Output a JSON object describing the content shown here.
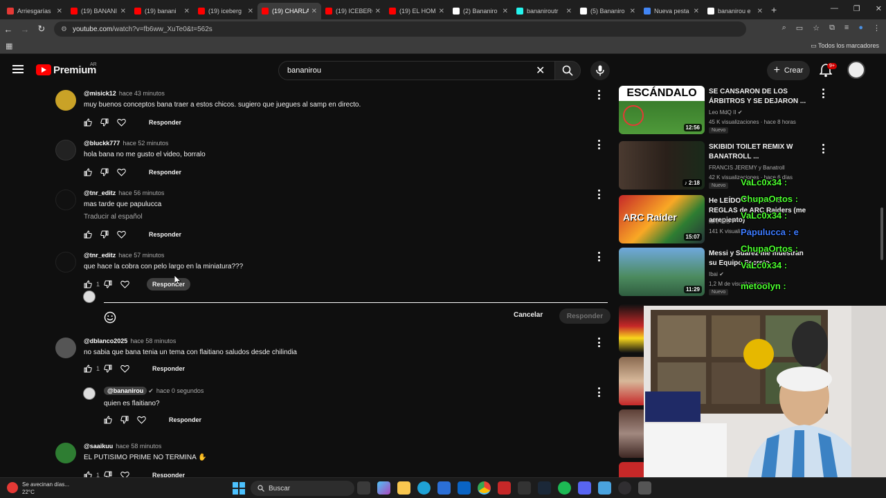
{
  "browser": {
    "tabs": [
      {
        "title": "Arriesgarías",
        "color": "#e53935"
      },
      {
        "title": "(19) BANANI",
        "color": "#ff0000"
      },
      {
        "title": "(19) banani",
        "color": "#ff0000"
      },
      {
        "title": "(19) iceberg",
        "color": "#ff0000"
      },
      {
        "title": "(19) CHARLA",
        "color": "#ff0000",
        "active": true
      },
      {
        "title": "(19) ICEBERG",
        "color": "#ff0000"
      },
      {
        "title": "(19) EL HOM",
        "color": "#ff0000"
      },
      {
        "title": "(2) Bananiro",
        "color": "#ffffff"
      },
      {
        "title": "bananiroutr",
        "color": "#25f4ee"
      },
      {
        "title": "(5) Bananiro",
        "color": "#ffffff"
      },
      {
        "title": "Nueva pesta",
        "color": "#4285f4"
      },
      {
        "title": "bananirou e",
        "color": "#ffffff"
      }
    ],
    "new_tab": "+",
    "url_host": "youtube.com",
    "url_path": "/watch?v=fb6ww_XuTe0&t=562s",
    "all_bookmarks": "Todos los marcadores"
  },
  "header": {
    "brand": "Premium",
    "region": "AR",
    "search_value": "bananirou",
    "create_label": "Crear",
    "notif_count": "9+"
  },
  "comments": [
    {
      "author": "@misick12",
      "time": "hace 43 minutos",
      "text": "muy buenos conceptos bana traer a estos chicos. sugiero que juegues al samp en directo.",
      "reply": "Responder",
      "avatar_color": "#c9a227"
    },
    {
      "author": "@bluckk777",
      "time": "hace 52 minutos",
      "text": "hola bana no me gusto el video, borralo",
      "reply": "Responder",
      "avatar_color": "#222222"
    },
    {
      "author": "@tnr_editz",
      "time": "hace 56 minutos",
      "text": "mas tarde que papulucca",
      "translate": "Traducir al español",
      "reply": "Responder",
      "avatar_color": "#111111"
    },
    {
      "author": "@tnr_editz",
      "time": "hace 57 minutos",
      "text": "que hace la cobra con pelo largo en la miniatura???",
      "likes": "1",
      "reply": "Responder",
      "avatar_color": "#111111"
    },
    {
      "author": "@dblanco2025",
      "time": "hace 58 minutos",
      "text": "no sabia que bana tenia un tema con flaitiano saludos desde chilindia",
      "likes": "1",
      "reply": "Responder",
      "avatar_color": "#555555"
    },
    {
      "author": "@bananirou",
      "time": "hace 0 segundos",
      "text": "quien es flaitiano?",
      "reply": "Responder",
      "avatar_color": "#dddddd"
    },
    {
      "author": "@saaikuu",
      "time": "hace 58 minutos",
      "text": "EL PUTISIMO PRIME NO TERMINA",
      "likes": "1",
      "reply": "Responder",
      "avatar_color": "#2e7d32"
    }
  ],
  "reply_box": {
    "value": "",
    "cancel_label": "Cancelar",
    "submit_label": "Responder"
  },
  "sidebar": [
    {
      "title": "SE CANSARON DE LOS ÁRBITROS Y SE DEJARON ...",
      "thumb_text": "ESCÁNDALO",
      "channel": "Leo MdQ II",
      "meta": "45 K visualizaciones · hace 8 horas",
      "badge": "Nuevo",
      "duration": "12:56",
      "thumb_color": "#3b7d2a"
    },
    {
      "title": "SKIBIDI TOILET REMIX W BANATROLL ...",
      "channel": "FRANCIS JEREMY y Banatroll",
      "meta": "42 K visualizaciones · hace 6 días",
      "badge": "Nuevo",
      "duration": "2:18",
      "thumb_color": "#3a2a22"
    },
    {
      "title": "He LEÍDO TODAS LAS REGLAS de ARC Raiders (me arrepiento)",
      "thumb_text": "ARC Raider",
      "channel": "MAFIUS",
      "meta": "141 K visualizaciones",
      "duration": "15:07",
      "thumb_color": "#7a1a1a"
    },
    {
      "title": "Messi y Suárez me muestran su Equipo Secreto",
      "channel": "Ibai",
      "meta": "1,2 M de visualizaciones",
      "badge": "Nuevo",
      "duration": "11:29",
      "thumb_color": "#3f8a5a"
    }
  ],
  "chat_overlay": [
    {
      "text": "VaLc0x34 :",
      "color": "#4cff2f"
    },
    {
      "text": "ChupaOrtos :",
      "color": "#4cff2f"
    },
    {
      "text": "VaLc0x34 :",
      "color": "#4cff2f"
    },
    {
      "text": "Papulucca : e",
      "color": "#3e7bff"
    },
    {
      "text": "ChupaOrtos :",
      "color": "#4cff2f"
    },
    {
      "text": "VaLc0x34 :",
      "color": "#4cff2f"
    },
    {
      "text": "metoolyn :",
      "color": "#4cff2f"
    }
  ],
  "taskbar": {
    "weather_title": "Se avecinan días...",
    "weather_temp": "22°C",
    "search_label": "Buscar"
  }
}
